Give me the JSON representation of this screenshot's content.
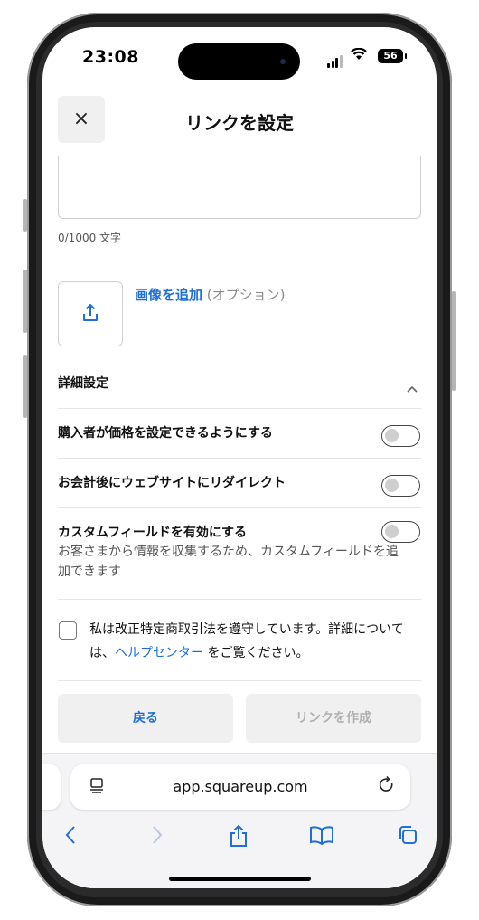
{
  "status_bar": {
    "time": "23:08",
    "battery": "56"
  },
  "header": {
    "close_icon": "×",
    "title": "リンクを設定"
  },
  "description": {
    "counter": "0/1000 文字"
  },
  "image_upload": {
    "add_label": "画像を追加",
    "optional": " (オプション)"
  },
  "details": {
    "title": "詳細設定",
    "rows": [
      {
        "label": "購入者が価格を設定できるようにする",
        "enabled": false
      },
      {
        "label": "お会計後にウェブサイトにリダイレクト",
        "enabled": false
      },
      {
        "label": "カスタムフィールドを有効にする",
        "sub": "お客さまから情報を収集するため、カスタムフィールドを追加できます",
        "enabled": false
      }
    ]
  },
  "consent": {
    "text_before": "私は改正特定商取引法を遵守しています。詳細については、",
    "link": "ヘルプセンター",
    "text_after": " をご覧ください。"
  },
  "actions": {
    "back": "戻る",
    "create": "リンクを作成"
  },
  "browser": {
    "url": "app.squareup.com"
  },
  "colors": {
    "accent": "#1f6fd6",
    "disabled_text": "#b0b0b0",
    "button_bg": "#f0f0f0"
  }
}
